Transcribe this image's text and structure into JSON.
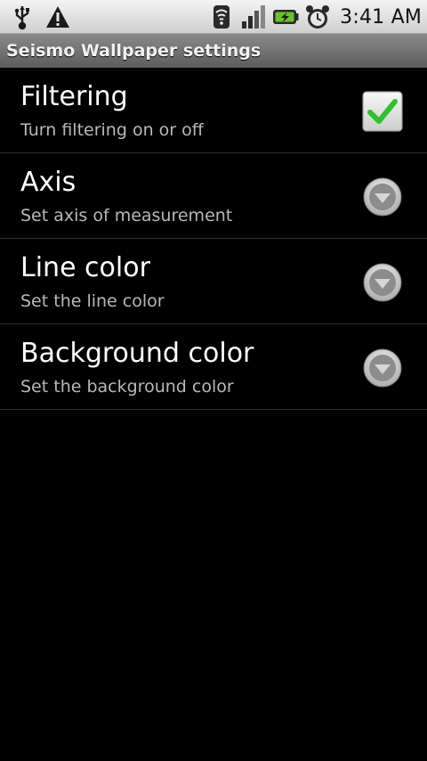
{
  "status_bar": {
    "left_icons": [
      "usb-icon",
      "warning-icon"
    ],
    "right_icons": [
      "wifi-icon",
      "signal-icon",
      "battery-charging-icon",
      "alarm-clock-icon"
    ],
    "time": "3:41 AM"
  },
  "title_bar": {
    "title": "Seismo Wallpaper settings"
  },
  "preferences": [
    {
      "title": "Filtering",
      "summary": "Turn filtering on or off",
      "widget": "checkbox",
      "checked": true
    },
    {
      "title": "Axis",
      "summary": "Set axis of measurement",
      "widget": "dropdown-arrow"
    },
    {
      "title": "Line color",
      "summary": "Set the line color",
      "widget": "dropdown-arrow"
    },
    {
      "title": "Background color",
      "summary": "Set the background color",
      "widget": "dropdown-arrow"
    }
  ],
  "colors": {
    "background": "#000000",
    "checkmark": "#2fc12f",
    "title_bar": "#6e6e6e"
  }
}
